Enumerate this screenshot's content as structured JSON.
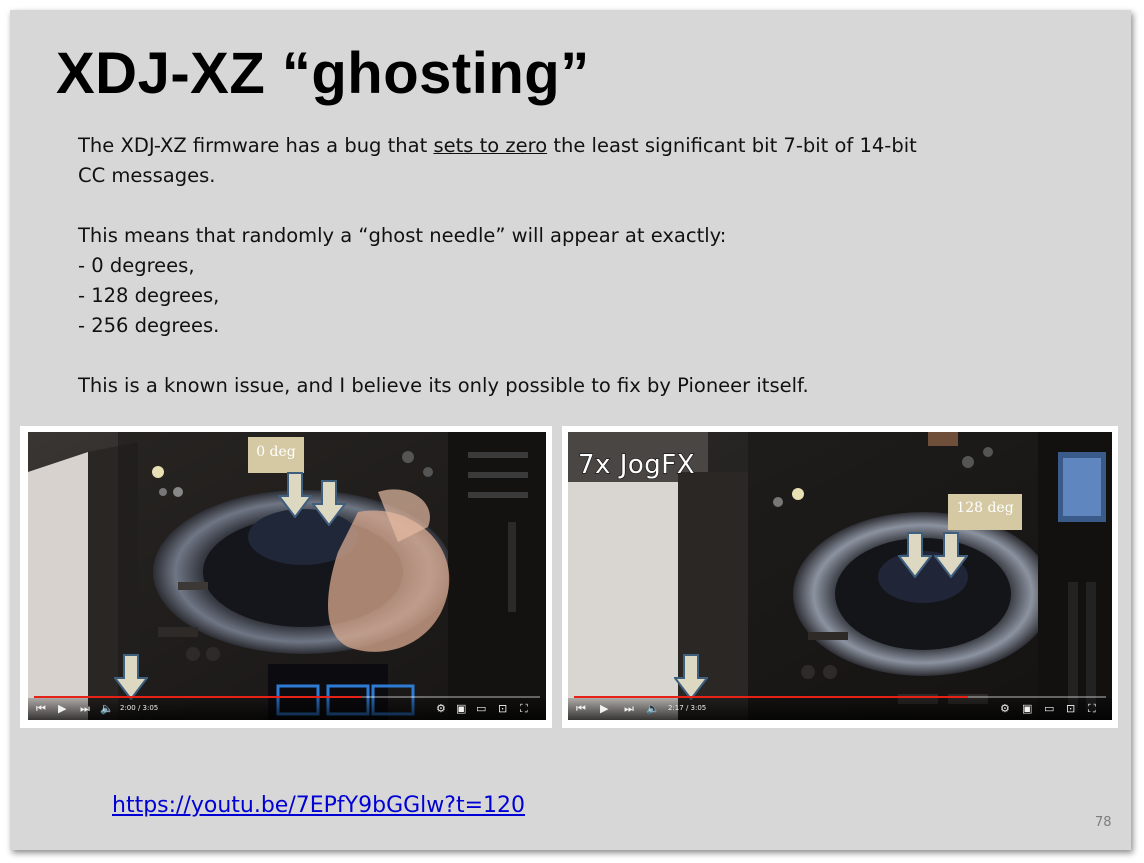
{
  "slide": {
    "title": "XDJ-XZ “ghosting”",
    "para1_a": "The XDJ-XZ firmware has a bug that ",
    "para1_u": "sets to zero",
    "para1_b": " the least significant bit 7-bit of 14-bit",
    "para1_c": "CC messages.",
    "para2": "This means that randomly a “ghost needle” will appear at exactly:",
    "bullets": [
      "- 0 degrees,",
      "- 128 degrees,",
      "- 256 degrees."
    ],
    "para3": "This is a known issue, and I believe its only possible to fix by Pioneer itself.",
    "link": "https://youtu.be/7EPfY9bGGlw?t=120",
    "page_number": "78"
  },
  "screenshot_left": {
    "label": "0 deg",
    "time": "2:00 / 3:05",
    "progress": 0.649
  },
  "screenshot_right": {
    "overlay_text": "7x JogFX",
    "label": "128 deg",
    "time": "2:17 / 3:05",
    "progress": 0.741
  },
  "colors": {
    "slide_bg": "#d7d7d7",
    "link": "#0000d4",
    "label_box": "#d4c9a3",
    "arrow_fill": "#ddd8c2",
    "arrow_stroke": "#3f5f7f",
    "progress": "#e62117"
  },
  "icons": [
    "skip-previous-icon",
    "play-icon",
    "skip-next-icon",
    "volume-icon",
    "settings-icon",
    "miniplayer-icon",
    "theater-icon",
    "cast-icon",
    "fullscreen-icon",
    "down-arrow-icon"
  ]
}
